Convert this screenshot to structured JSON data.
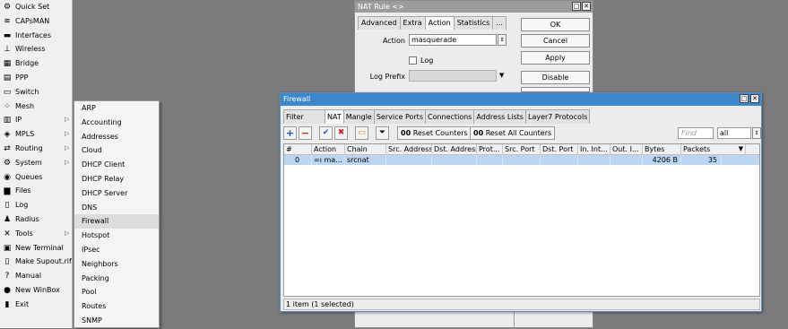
{
  "sidebar": {
    "items": [
      {
        "label": "Quick Set",
        "icon": "quick-set-icon",
        "glyph": "⚙",
        "arrow": false
      },
      {
        "label": "CAPsMAN",
        "icon": "capsman-icon",
        "glyph": "≋",
        "arrow": false
      },
      {
        "label": "Interfaces",
        "icon": "interfaces-icon",
        "glyph": "▬",
        "arrow": false
      },
      {
        "label": "Wireless",
        "icon": "wireless-icon",
        "glyph": "⊥",
        "arrow": false
      },
      {
        "label": "Bridge",
        "icon": "bridge-icon",
        "glyph": "▦",
        "arrow": false
      },
      {
        "label": "PPP",
        "icon": "ppp-icon",
        "glyph": "▤",
        "arrow": false
      },
      {
        "label": "Switch",
        "icon": "switch-icon",
        "glyph": "▭",
        "arrow": false
      },
      {
        "label": "Mesh",
        "icon": "mesh-icon",
        "glyph": "⁘",
        "arrow": false
      },
      {
        "label": "IP",
        "icon": "ip-icon",
        "glyph": "▥",
        "arrow": true
      },
      {
        "label": "MPLS",
        "icon": "mpls-icon",
        "glyph": "◈",
        "arrow": true
      },
      {
        "label": "Routing",
        "icon": "routing-icon",
        "glyph": "⇄",
        "arrow": true
      },
      {
        "label": "System",
        "icon": "system-icon",
        "glyph": "⚙",
        "arrow": true
      },
      {
        "label": "Queues",
        "icon": "queues-icon",
        "glyph": "◉",
        "arrow": false
      },
      {
        "label": "Files",
        "icon": "files-icon",
        "glyph": "▆",
        "arrow": false
      },
      {
        "label": "Log",
        "icon": "log-icon",
        "glyph": "▯",
        "arrow": false
      },
      {
        "label": "Radius",
        "icon": "radius-icon",
        "glyph": "♟",
        "arrow": false
      },
      {
        "label": "Tools",
        "icon": "tools-icon",
        "glyph": "✕",
        "arrow": true
      },
      {
        "label": "New Terminal",
        "icon": "terminal-icon",
        "glyph": "▣",
        "arrow": false
      },
      {
        "label": "Make Supout.rif",
        "icon": "supout-icon",
        "glyph": "▯",
        "arrow": false
      },
      {
        "label": "Manual",
        "icon": "manual-icon",
        "glyph": "?",
        "arrow": false
      },
      {
        "label": "New WinBox",
        "icon": "winbox-icon",
        "glyph": "●",
        "arrow": false
      },
      {
        "label": "Exit",
        "icon": "exit-icon",
        "glyph": "▮",
        "arrow": false
      }
    ]
  },
  "submenu": {
    "items": [
      "ARP",
      "Accounting",
      "Addresses",
      "Cloud",
      "DHCP Client",
      "DHCP Relay",
      "DHCP Server",
      "DNS",
      "Firewall",
      "Hotspot",
      "IPsec",
      "Neighbors",
      "Packing",
      "Pool",
      "Routes",
      "SNMP"
    ],
    "highlighted": "Firewall"
  },
  "nat_rule": {
    "title": "NAT Rule <>",
    "tabs": [
      "Advanced",
      "Extra",
      "Action",
      "Statistics",
      "..."
    ],
    "active_tab": "Action",
    "action_label": "Action",
    "action_value": "masquerade",
    "log_label": "Log",
    "log_prefix_label": "Log Prefix",
    "log_prefix_value": "",
    "buttons": [
      "OK",
      "Cancel",
      "Apply",
      "Disable"
    ]
  },
  "firewall": {
    "title": "Firewall",
    "tabs": [
      "Filter Rules",
      "NAT",
      "Mangle",
      "Service Ports",
      "Connections",
      "Address Lists",
      "Layer7 Protocols"
    ],
    "active_tab": "NAT",
    "toolbar": {
      "reset_counters": "Reset Counters",
      "reset_all_counters": "Reset All Counters",
      "counter_prefix": "00",
      "find_placeholder": "Find",
      "filter_value": "all"
    },
    "columns": [
      "#",
      "Action",
      "Chain",
      "Src. Address",
      "Dst. Address",
      "Prot...",
      "Src. Port",
      "Dst. Port",
      "In. Int...",
      "Out. I...",
      "Bytes",
      "Packets"
    ],
    "rows": [
      {
        "num": "0",
        "action": "=ı ma...",
        "chain": "srcnat",
        "src_address": "",
        "dst_address": "",
        "protocol": "",
        "src_port": "",
        "dst_port": "",
        "in_int": "",
        "out_int": "",
        "bytes": "4206 B",
        "packets": "35"
      }
    ],
    "status": "1 item (1 selected)"
  },
  "colors": {
    "desktop": "#7b7b7b",
    "firewall_titlebar": "#3d88cc",
    "selected_row": "#bcd6f2",
    "add_icon": "#1a4fb8",
    "remove_icon": "#cc2222",
    "enable_icon": "#2255aa"
  }
}
